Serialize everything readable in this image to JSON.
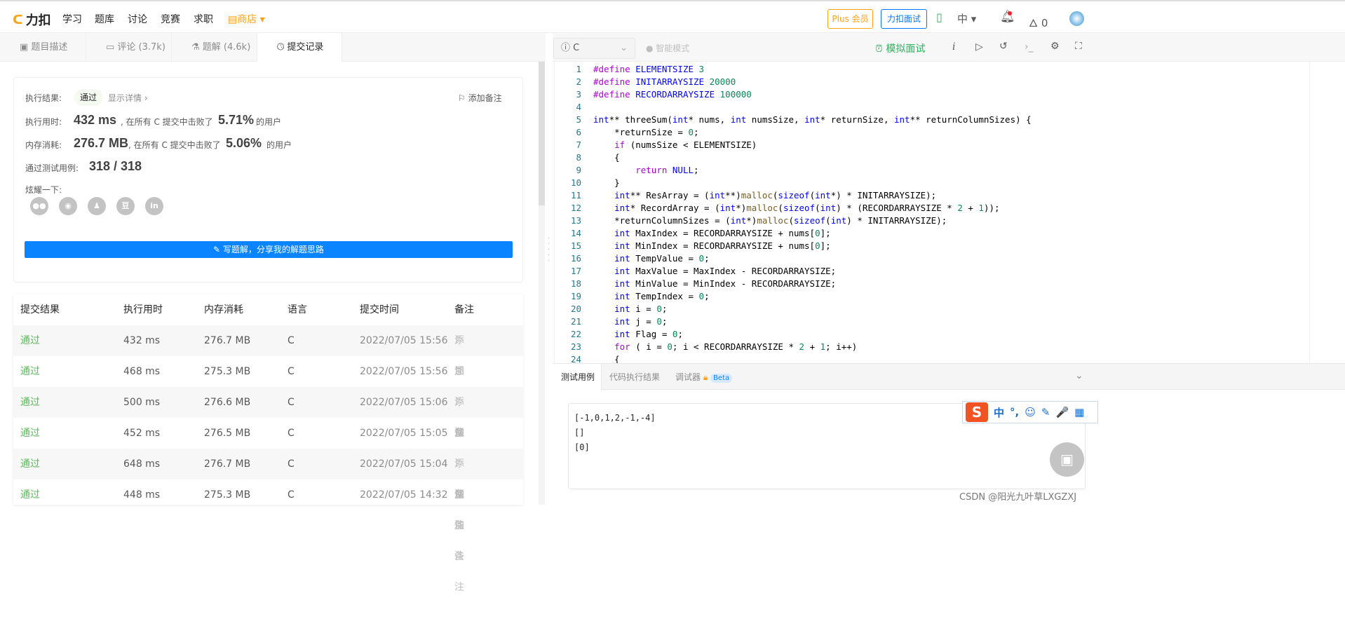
{
  "nav": {
    "logo": "力扣",
    "items": [
      "学习",
      "题库",
      "讨论",
      "竞赛",
      "求职"
    ],
    "shop": "商店",
    "plus": "Plus 会员",
    "interview": "力扣面试",
    "lang": "中",
    "points": "0"
  },
  "tabs": [
    "题目描述",
    "评论 (3.7k)",
    "题解 (4.6k)",
    "提交记录"
  ],
  "result": {
    "label": "执行结果:",
    "status": "通过",
    "details": "显示详情 ›",
    "add_note": "添加备注",
    "time_label": "执行用时:",
    "time": "432 ms",
    "time_mid": ", 在所有 C 提交中击败了",
    "time_pct": "5.71%",
    "users": "的用户",
    "mem_label": "内存消耗:",
    "mem": "276.7 MB",
    "mem_mid": ", 在所有 C 提交中击败了",
    "mem_pct": "5.06%",
    "cases_label": "通过测试用例:",
    "cases": "318 / 318",
    "share_label": "炫耀一下:",
    "share_icons": [
      "wechat",
      "weibo",
      "qq",
      "douban",
      "linkedin"
    ],
    "write_btn": "写题解，分享我的解题思路"
  },
  "table": {
    "headers": [
      "提交结果",
      "执行用时",
      "内存消耗",
      "语言",
      "提交时间",
      "备注"
    ],
    "rows": [
      {
        "result": "通过",
        "time": "432 ms",
        "mem": "276.7 MB",
        "lang": "C",
        "date": "2022/07/05 15:56",
        "note": "添加备注"
      },
      {
        "result": "通过",
        "time": "468 ms",
        "mem": "275.3 MB",
        "lang": "C",
        "date": "2022/07/05 15:56",
        "note": "添加备注"
      },
      {
        "result": "通过",
        "time": "500 ms",
        "mem": "276.6 MB",
        "lang": "C",
        "date": "2022/07/05 15:06",
        "note": "添加备注"
      },
      {
        "result": "通过",
        "time": "452 ms",
        "mem": "276.5 MB",
        "lang": "C",
        "date": "2022/07/05 15:05",
        "note": "添加备注"
      },
      {
        "result": "通过",
        "time": "648 ms",
        "mem": "276.7 MB",
        "lang": "C",
        "date": "2022/07/05 15:04",
        "note": "添加备注"
      },
      {
        "result": "通过",
        "time": "448 ms",
        "mem": "275.3 MB",
        "lang": "C",
        "date": "2022/07/05 14:32",
        "note": "添加备注"
      }
    ]
  },
  "editor": {
    "language": "C",
    "mode": "智能模式",
    "mock": "模拟面试",
    "code": [
      "#define ELEMENTSIZE 3",
      "#define INITARRAYSIZE 20000",
      "#define RECORDARRAYSIZE 100000",
      "",
      "int** threeSum(int* nums, int numsSize, int* returnSize, int** returnColumnSizes) {",
      "    *returnSize = 0;",
      "    if (numsSize < ELEMENTSIZE)",
      "    {",
      "        return NULL;",
      "    }",
      "    int** ResArray = (int**)malloc(sizeof(int*) * INITARRAYSIZE);",
      "    int* RecordArray = (int*)malloc(sizeof(int) * (RECORDARRAYSIZE * 2 + 1));",
      "    *returnColumnSizes = (int*)malloc(sizeof(int) * INITARRAYSIZE);",
      "    int MaxIndex = RECORDARRAYSIZE + nums[0];",
      "    int MinIndex = RECORDARRAYSIZE + nums[0];",
      "    int TempValue = 0;",
      "    int MaxValue = MaxIndex - RECORDARRAYSIZE;",
      "    int MinValue = MinIndex - RECORDARRAYSIZE;",
      "    int TempIndex = 0;",
      "    int i = 0;",
      "    int j = 0;",
      "    int Flag = 0;",
      "    for ( i = 0; i < RECORDARRAYSIZE * 2 + 1; i++)",
      "    {"
    ]
  },
  "console": {
    "tabs": [
      "测试用例",
      "代码执行结果",
      "调试器"
    ],
    "beta": "Beta",
    "input": [
      "[-1,0,1,2,-1,-4]",
      "[]",
      "[0]"
    ]
  },
  "ime": {
    "items": [
      "中",
      "°,",
      "☺",
      "✎",
      "🎤",
      "▦"
    ]
  },
  "watermark": "CSDN @阳光九叶草LXGZXJ",
  "colors": {
    "accent": "#0a84ff",
    "pass": "#5cb85c",
    "shop": "#ffa116",
    "mock": "#2db55d"
  }
}
